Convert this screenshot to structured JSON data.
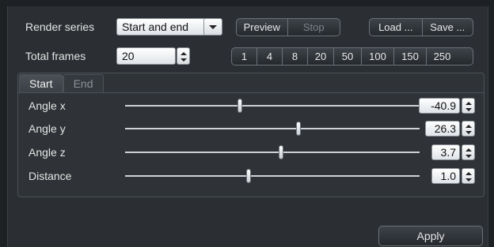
{
  "render_series": {
    "label": "Render series",
    "selected": "Start and end"
  },
  "actions": {
    "preview": "Preview",
    "stop": "Stop",
    "load": "Load ...",
    "save": "Save ..."
  },
  "total_frames": {
    "label": "Total frames",
    "value": "20",
    "presets": [
      "1",
      "4",
      "8",
      "20",
      "50",
      "100",
      "150",
      "250"
    ]
  },
  "tabs": {
    "start": "Start",
    "end": "End"
  },
  "params": [
    {
      "label": "Angle x",
      "value": "-40.9",
      "level": 0.39
    },
    {
      "label": "Angle y",
      "value": "26.3",
      "level": 0.59
    },
    {
      "label": "Angle z",
      "value": "3.7",
      "level": 0.53
    },
    {
      "label": "Distance",
      "value": "1.0",
      "level": 0.42
    }
  ],
  "apply": "Apply"
}
